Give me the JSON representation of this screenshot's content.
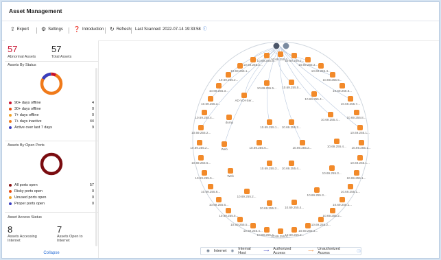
{
  "app": {
    "title": "Asset Management"
  },
  "toolbar": {
    "export": "Export",
    "settings": "Settings",
    "introduction": "Introduction",
    "refresh": "Refresh",
    "last_scanned": "Last Scanned: 2022-07-14 19:33:58"
  },
  "summary": {
    "abnormal_value": "57",
    "abnormal_label": "Abnormal Assets",
    "total_value": "57",
    "total_label": "Total Assets"
  },
  "status": {
    "title": "Assets By Status",
    "rows": [
      {
        "label": "90+ days offline",
        "value": "4",
        "color": "#c8102e"
      },
      {
        "label": "30+ days offline",
        "value": "0",
        "color": "#e84a0e"
      },
      {
        "label": "7+ days offline",
        "value": "0",
        "color": "#f0a020"
      },
      {
        "label": "7+ days inactive",
        "value": "44",
        "color": "#f07a1a"
      },
      {
        "label": "Active over last 7 days",
        "value": "9",
        "color": "#3a3fbf"
      }
    ]
  },
  "ports": {
    "title": "Assets By Open Ports",
    "rows": [
      {
        "label": "All ports open",
        "value": "57",
        "color": "#8b0f12"
      },
      {
        "label": "Risky ports open",
        "value": "0",
        "color": "#e84a0e"
      },
      {
        "label": "Unused ports open",
        "value": "0",
        "color": "#f0a020"
      },
      {
        "label": "Proper ports open",
        "value": "0",
        "color": "#3a3fbf"
      }
    ]
  },
  "access": {
    "title": "Asset Access Status",
    "internet_value": "8",
    "internet_label": "Assets Accessing Internet",
    "open_value": "7",
    "open_label": "Assets Open to Internet"
  },
  "collapse": "Collapse",
  "graph": {
    "legend": {
      "internet": "Internet",
      "internal": "Internal Host",
      "authorized": "Authorized Access",
      "unauthorized": "Unauthorized Access"
    },
    "nodes": [
      "10.69.255.1...",
      "10.69.255.2...",
      "10.69.255.3...",
      "10.69.255.4...",
      "10.69.255.5...",
      "10.69.255.6...",
      "10.69.255.7...",
      "10.69.255.8...",
      "10.69.255.1...",
      "10.69.255.1...",
      "10.69.255.1...",
      "10.69.255.1...",
      "10.69.255.1...",
      "10.69.255.1...",
      "10.69.255.2...",
      "10.69.255.2...",
      "10.69.255.3...",
      "10.69.255.3...",
      "10.69.255.4...",
      "10.69.255.4...",
      "10.69.255.4...",
      "10.69.255.5...",
      "10.69.255.5...",
      "10.69.255.6...",
      "10.69.255.6...",
      "10.69.255.5...",
      "10.69.255.5...",
      "10.69.255.2...",
      "10.69.255.2...",
      "10.69.255.4...",
      "10.69.255.3...",
      "10.69.255.3...",
      "10.69.255.2...",
      "10.69.255.1...",
      "10.69.255.2...",
      "10.69.255.3...",
      "10.69.255.5...",
      "10.69.255.4...",
      "10.69.255.4...",
      "10.69.255.4...",
      "10.69.255.3...",
      "10.69.255.3...",
      "10.69.255.4...",
      "10.69.255.2...",
      "10.69.255.2...",
      "Web",
      "Web",
      "dump",
      "AD-VDI-Ser...",
      "10.69.255.5...",
      "10.69.255.2...",
      "10.69.255.4...",
      "10.69.255.3...",
      "10.69.255.6...",
      "10.69.255.1...",
      "10.69.255.2..."
    ]
  }
}
